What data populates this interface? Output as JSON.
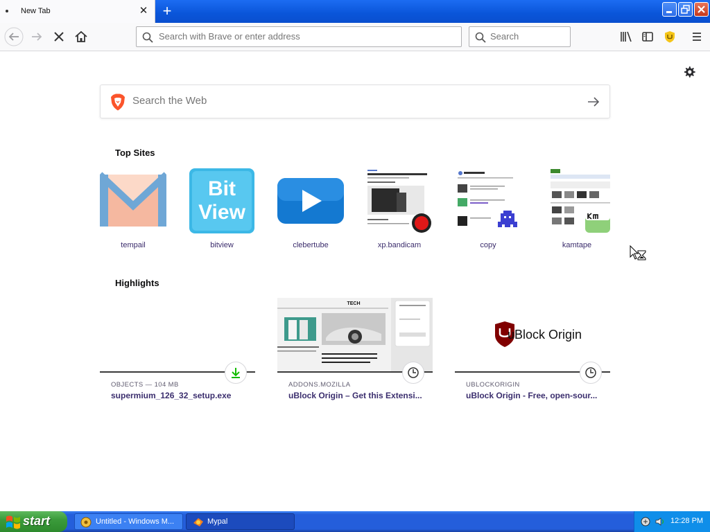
{
  "browser": {
    "tab_title": "New Tab",
    "url_placeholder": "Search with Brave or enter address",
    "search_placeholder": "Search"
  },
  "newtab": {
    "web_search_placeholder": "Search the Web",
    "top_sites_title": "Top Sites",
    "top_sites": [
      {
        "label": "tempail"
      },
      {
        "label": "bitview"
      },
      {
        "label": "clebertube"
      },
      {
        "label": "xp.bandicam"
      },
      {
        "label": "copy"
      },
      {
        "label": "kamtape"
      }
    ],
    "highlights_title": "Highlights",
    "highlights": [
      {
        "meta": "OBJECTS — 104 MB",
        "title": "supermium_126_32_setup.exe",
        "badge": "download-icon"
      },
      {
        "meta": "ADDONS.MOZILLA",
        "title": "uBlock Origin – Get this Extensi...",
        "badge": "clock-icon",
        "image_text": "TECH"
      },
      {
        "meta": "UBLOCKORIGIN",
        "title": "uBlock Origin - Free, open-sour...",
        "badge": "clock-icon",
        "image_text": "uBlock Origin"
      }
    ]
  },
  "thumbnails": {
    "bitview_line1": "Bit",
    "bitview_line2": "View"
  },
  "taskbar": {
    "start_label": "start",
    "tasks": [
      {
        "label": "Untitled - Windows M..."
      },
      {
        "label": "Mypal"
      }
    ],
    "clock": "12:28 PM"
  },
  "colors": {
    "xp_blue": "#245edb",
    "start_green": "#3b9b3b",
    "link_purple": "#3b2e6e",
    "brave_orange": "#fb542b"
  }
}
